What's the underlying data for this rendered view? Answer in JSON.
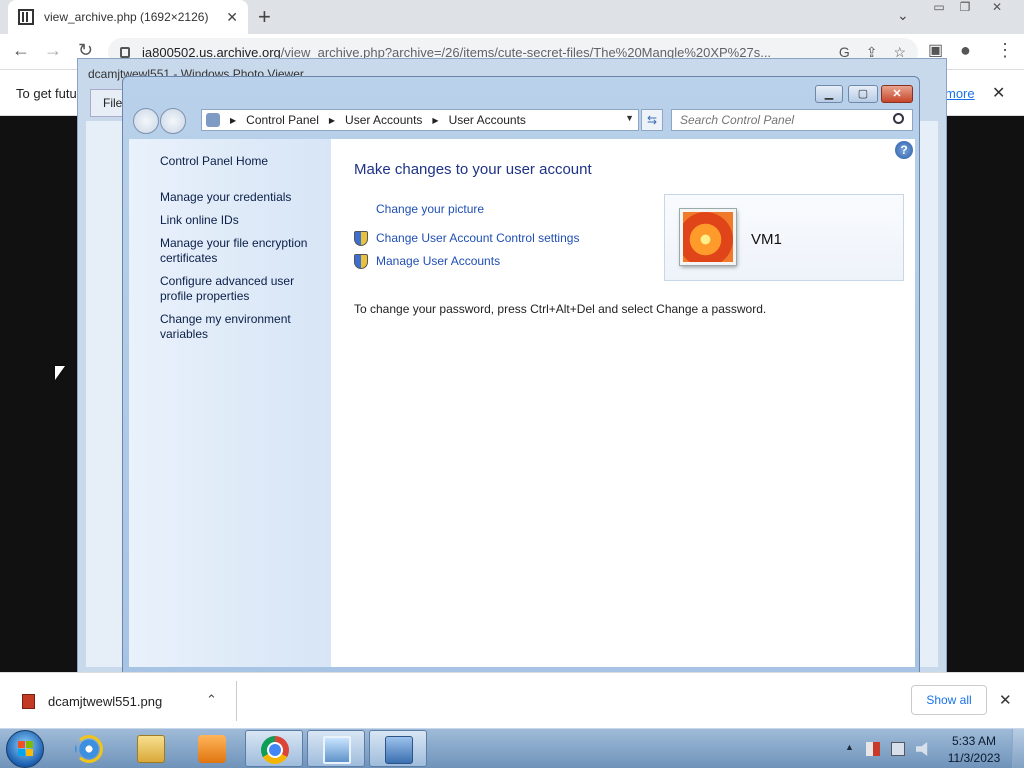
{
  "browser": {
    "tab_title": "view_archive.php (1692×2126)",
    "url_host": "ia800502.us.archive.org",
    "url_path": "/view_archive.php?archive=/26/items/cute-secret-files/The%20Mangle%20XP%27s...",
    "infobar_text": "To get futu",
    "infobar_more": "more"
  },
  "photo_viewer": {
    "title": "dcamjtwewl551 - Windows Photo Viewer",
    "menu_file": "File"
  },
  "control_panel": {
    "breadcrumb": [
      "Control Panel",
      "User Accounts",
      "User Accounts"
    ],
    "search_placeholder": "Search Control Panel",
    "nav": {
      "home": "Control Panel Home",
      "credentials": "Manage your credentials",
      "online_ids": "Link online IDs",
      "encryption": "Manage your file encryption certificates",
      "profile": "Configure advanced user profile properties",
      "environment": "Change my environment variables"
    },
    "heading": "Make changes to your user account",
    "tasks": {
      "picture": "Change your picture",
      "uac": "Change User Account Control settings",
      "manage": "Manage User Accounts"
    },
    "user_name": "VM1",
    "password_note": "To change your password, press Ctrl+Alt+Del and select Change a password."
  },
  "downloads": {
    "filename": "dcamjtwewl551.png",
    "show_all": "Show all"
  },
  "taskbar": {
    "time": "5:33 AM",
    "date": "11/3/2023",
    "apps": [
      "internet-explorer",
      "windows-explorer",
      "media-player",
      "google-chrome",
      "photo-viewer",
      "control-panel"
    ]
  }
}
